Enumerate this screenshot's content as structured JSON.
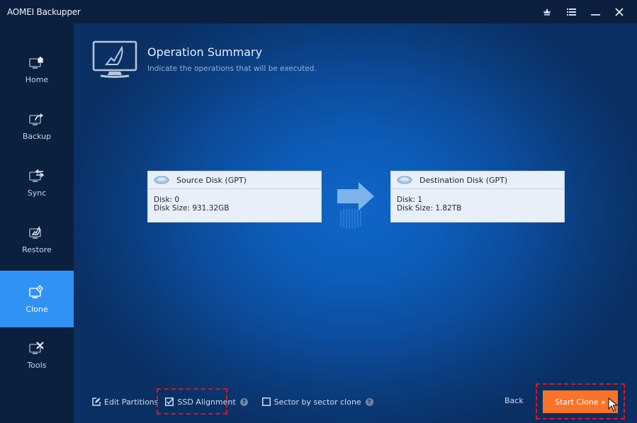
{
  "window": {
    "title": "AOMEI Backupper",
    "controls": [
      {
        "name": "upgrade-icon",
        "label": "Upgrade"
      },
      {
        "name": "menu-icon",
        "label": "Menu"
      },
      {
        "name": "minimize-icon",
        "label": "Minimize"
      },
      {
        "name": "close-icon",
        "label": "Close"
      }
    ]
  },
  "sidebar": {
    "items": [
      {
        "label": "Home",
        "icon": "home-icon",
        "active": false
      },
      {
        "label": "Backup",
        "icon": "backup-icon",
        "active": false
      },
      {
        "label": "Sync",
        "icon": "sync-icon",
        "active": false
      },
      {
        "label": "Restore",
        "icon": "restore-icon",
        "active": false
      },
      {
        "label": "Clone",
        "icon": "clone-icon",
        "active": true
      },
      {
        "label": "Tools",
        "icon": "tools-icon",
        "active": false
      }
    ]
  },
  "summary": {
    "title": "Operation Summary",
    "subtitle": "Indicate the operations that will be executed.",
    "icon": "monitor-icon"
  },
  "source_disk": {
    "title": "Source Disk (GPT)",
    "disk_line": "Disk: 0",
    "size_line": "Disk Size: 931.32GB"
  },
  "destination_disk": {
    "title": "Destination Disk (GPT)",
    "disk_line": "Disk: 1",
    "size_line": "Disk Size: 1.82TB"
  },
  "options": {
    "edit_partitions": {
      "label": "Edit Partitions"
    },
    "ssd_alignment": {
      "label": "SSD Alignment",
      "checked": true,
      "help": "?"
    },
    "sector_by_sector": {
      "label": "Sector by sector clone",
      "checked": false,
      "help": "?"
    }
  },
  "buttons": {
    "back": "Back",
    "start_clone": "Start Clone »"
  },
  "colors": {
    "accent": "#3092f5",
    "start_button": "#fa7328",
    "highlight_dash": "#e3141b",
    "sidebar_bg": "#0b1f3e"
  }
}
